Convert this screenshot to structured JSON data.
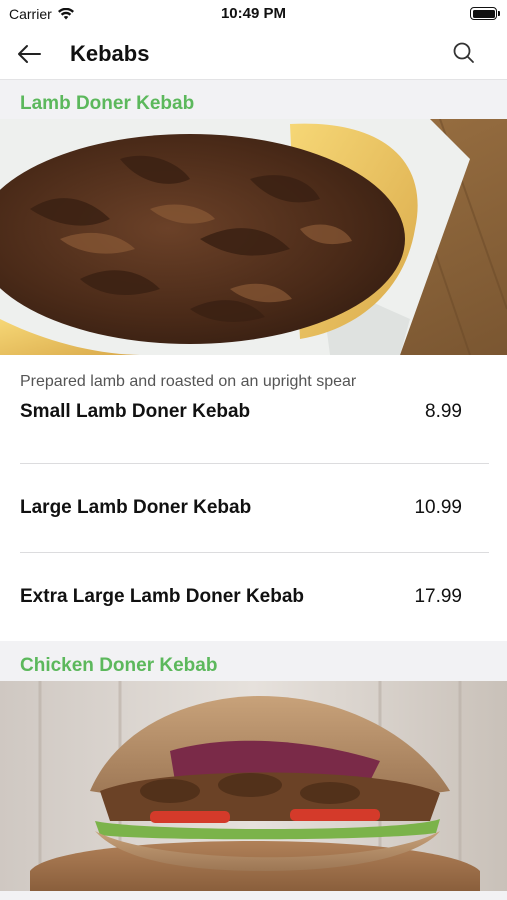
{
  "status_bar": {
    "carrier": "Carrier",
    "time": "10:49 PM",
    "battery_level": 1.0
  },
  "nav": {
    "title": "Kebabs",
    "back_icon": "arrow-left-icon",
    "search_icon": "search-icon"
  },
  "colors": {
    "section_green": "#5cb85c",
    "text": "#111111",
    "background": "#f2f2f4"
  },
  "sections": [
    {
      "title": "Lamb Doner Kebab",
      "description": "Prepared lamb and roasted on an upright spear",
      "items": [
        {
          "name": "Small Lamb Doner Kebab",
          "price": "8.99"
        },
        {
          "name": "Large Lamb Doner Kebab",
          "price": "10.99"
        },
        {
          "name": "Extra Large Lamb Doner Kebab",
          "price": "17.99"
        }
      ]
    },
    {
      "title": "Chicken Doner Kebab"
    }
  ]
}
